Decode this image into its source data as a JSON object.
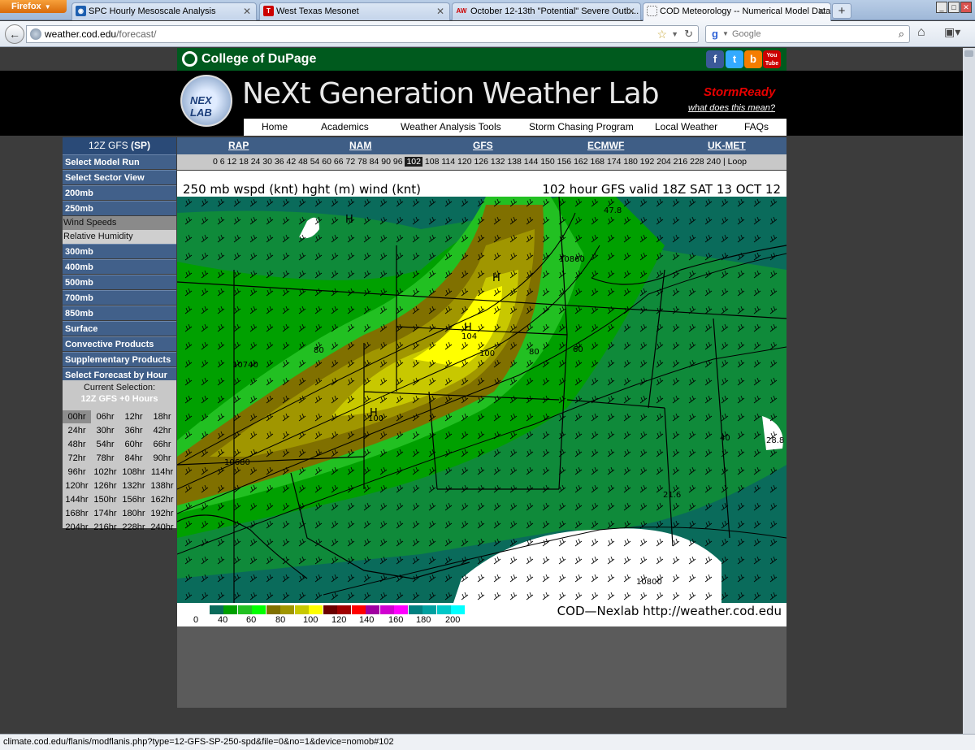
{
  "browser": {
    "app_button": "Firefox",
    "tabs": [
      {
        "label": "SPC Hourly Mesoscale Analysis",
        "icon": "spc-icon"
      },
      {
        "label": "West Texas Mesonet",
        "icon": "texas-tech-icon"
      },
      {
        "label": "October 12-13th \"Potential\" Severe Outb...",
        "icon": "aw-icon"
      },
      {
        "label": "COD Meteorology -- Numerical Model Data",
        "icon": "page-icon",
        "active": true
      }
    ],
    "url_host": "weather.cod.edu",
    "url_path": "/forecast/",
    "search_placeholder": "Google",
    "status_text": "climate.cod.edu/flanis/modflanis.php?type=12-GFS-SP-250-spd&file=0&no=1&device=nomob#102"
  },
  "site": {
    "header_brand": "College of DuPage",
    "logo_text": "NEX LAB",
    "banner_title": "NeXt Generation Weather Lab",
    "stormready": "StormReady",
    "stormready_link": "what does this mean?",
    "social": [
      "f",
      "t",
      "b",
      "You Tube"
    ],
    "nav": [
      "Home",
      "Academics",
      "Weather Analysis Tools",
      "Storm Chasing Program",
      "Local Weather",
      "FAQs"
    ]
  },
  "sidebar": {
    "model_title_prefix": "12Z GFS ",
    "model_title_region": "(SP)",
    "items": [
      "Select Model Run",
      "Select Sector View",
      "200mb",
      "250mb"
    ],
    "subitems": [
      "Wind Speeds",
      "Relative Humidity"
    ],
    "items2": [
      "300mb",
      "400mb",
      "500mb",
      "700mb",
      "850mb",
      "Surface",
      "Convective Products",
      "Supplementary Products",
      "Select Forecast by Hour"
    ],
    "selection_label": "Current Selection:",
    "selection_value": "12Z GFS +0 Hours",
    "hours": [
      [
        "00hr",
        "06hr",
        "12hr",
        "18hr"
      ],
      [
        "24hr",
        "30hr",
        "36hr",
        "42hr"
      ],
      [
        "48hr",
        "54hr",
        "60hr",
        "66hr"
      ],
      [
        "72hr",
        "78hr",
        "84hr",
        "90hr"
      ],
      [
        "96hr",
        "102hr",
        "108hr",
        "114hr"
      ],
      [
        "120hr",
        "126hr",
        "132hr",
        "138hr"
      ],
      [
        "144hr",
        "150hr",
        "156hr",
        "162hr"
      ],
      [
        "168hr",
        "174hr",
        "180hr",
        "192hr"
      ],
      [
        "204hr",
        "216hr",
        "228hr",
        "240hr"
      ]
    ],
    "selected_hour": "00hr"
  },
  "models": [
    "RAP",
    "NAM",
    "GFS",
    "ECMWF",
    "UK-MET"
  ],
  "hourbar": {
    "before": "0 6 12 18 24 30 36 42 48 54 60 66 72 78 84 90 96",
    "current": "102",
    "after": "108 114 120 126 132 138 144 150 156 162 168 174 180 192 204 216 228 240 | Loop"
  },
  "map": {
    "title_left": "250 mb wspd (knt) hght (m) wind (knt)",
    "title_right": "102 hour GFS valid 18Z SAT 13 OCT 12",
    "credit": "COD—Nexlab http://weather.cod.edu",
    "contour_labels": [
      "10740",
      "10680",
      "10800",
      "10860"
    ],
    "speed_labels": [
      "104",
      "100",
      "100",
      "80",
      "80",
      "60",
      "47.8",
      "40",
      "28.8",
      "21.6"
    ],
    "highs": [
      "H",
      "H",
      "H",
      "H"
    ],
    "legend_colors": [
      "#ffffff",
      "#0a6b5b",
      "#00a000",
      "#22c022",
      "#00ff00",
      "#807000",
      "#a09600",
      "#c8c800",
      "#ffff00",
      "#6b0000",
      "#a00000",
      "#ff0000",
      "#a000a0",
      "#d000d0",
      "#ff00ff",
      "#008080",
      "#00a0a0",
      "#00c8c8",
      "#00ffff"
    ],
    "legend_labels": [
      "0",
      "40",
      "60",
      "80",
      "100",
      "120",
      "140",
      "160",
      "180",
      "200"
    ]
  }
}
